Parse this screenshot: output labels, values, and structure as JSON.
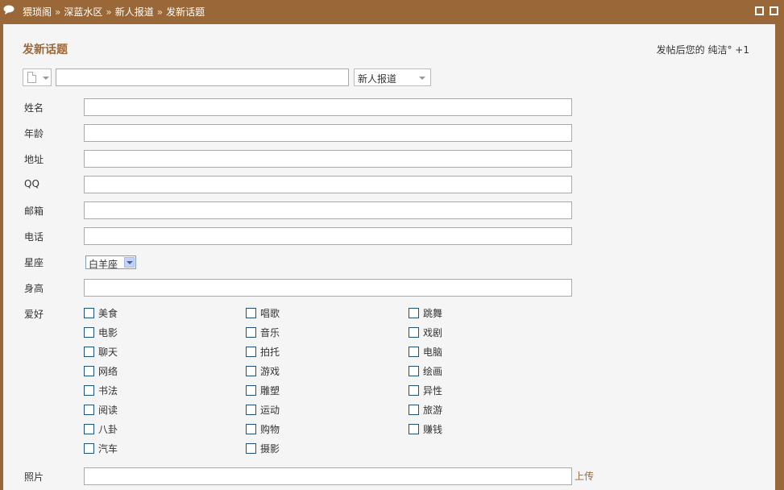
{
  "header": {
    "breadcrumbs": [
      "猥琐阁",
      "深蓝水区",
      "新人报道",
      "发新话题"
    ],
    "separator": "»"
  },
  "form": {
    "title": "发新话题",
    "reward_note": "发帖后您的 纯洁° +1",
    "subject_value": "",
    "category_selected": "新人报道",
    "fields": {
      "name_label": "姓名",
      "age_label": "年龄",
      "address_label": "地址",
      "qq_label": "QQ",
      "email_label": "邮箱",
      "phone_label": "电话",
      "star_label": "星座",
      "star_selected": "白羊座",
      "height_label": "身高",
      "hobby_label": "爱好",
      "photo_label": "照片",
      "upload_label": "上传"
    },
    "hobbies": [
      {
        "label": "美食",
        "checked": false
      },
      {
        "label": "唱歌",
        "checked": false
      },
      {
        "label": "跳舞",
        "checked": false
      },
      {
        "label": "电影",
        "checked": false
      },
      {
        "label": "音乐",
        "checked": false
      },
      {
        "label": "戏剧",
        "checked": false
      },
      {
        "label": "聊天",
        "checked": false
      },
      {
        "label": "拍托",
        "checked": false
      },
      {
        "label": "电脑",
        "checked": false
      },
      {
        "label": "网络",
        "checked": false
      },
      {
        "label": "游戏",
        "checked": false
      },
      {
        "label": "绘画",
        "checked": false
      },
      {
        "label": "书法",
        "checked": false
      },
      {
        "label": "雕塑",
        "checked": false
      },
      {
        "label": "异性",
        "checked": false
      },
      {
        "label": "阅读",
        "checked": false
      },
      {
        "label": "运动",
        "checked": false
      },
      {
        "label": "旅游",
        "checked": false
      },
      {
        "label": "八卦",
        "checked": false
      },
      {
        "label": "购物",
        "checked": false
      },
      {
        "label": "赚钱",
        "checked": false
      },
      {
        "label": "汽车",
        "checked": false
      },
      {
        "label": "摄影",
        "checked": false
      }
    ]
  },
  "colors": {
    "accent": "#9a6838",
    "panel_bg": "#f5f5f5",
    "checkbox_border": "#1c5180"
  },
  "icons": {
    "header": "speech-bubble-icon",
    "post_icon": "document-icon"
  }
}
